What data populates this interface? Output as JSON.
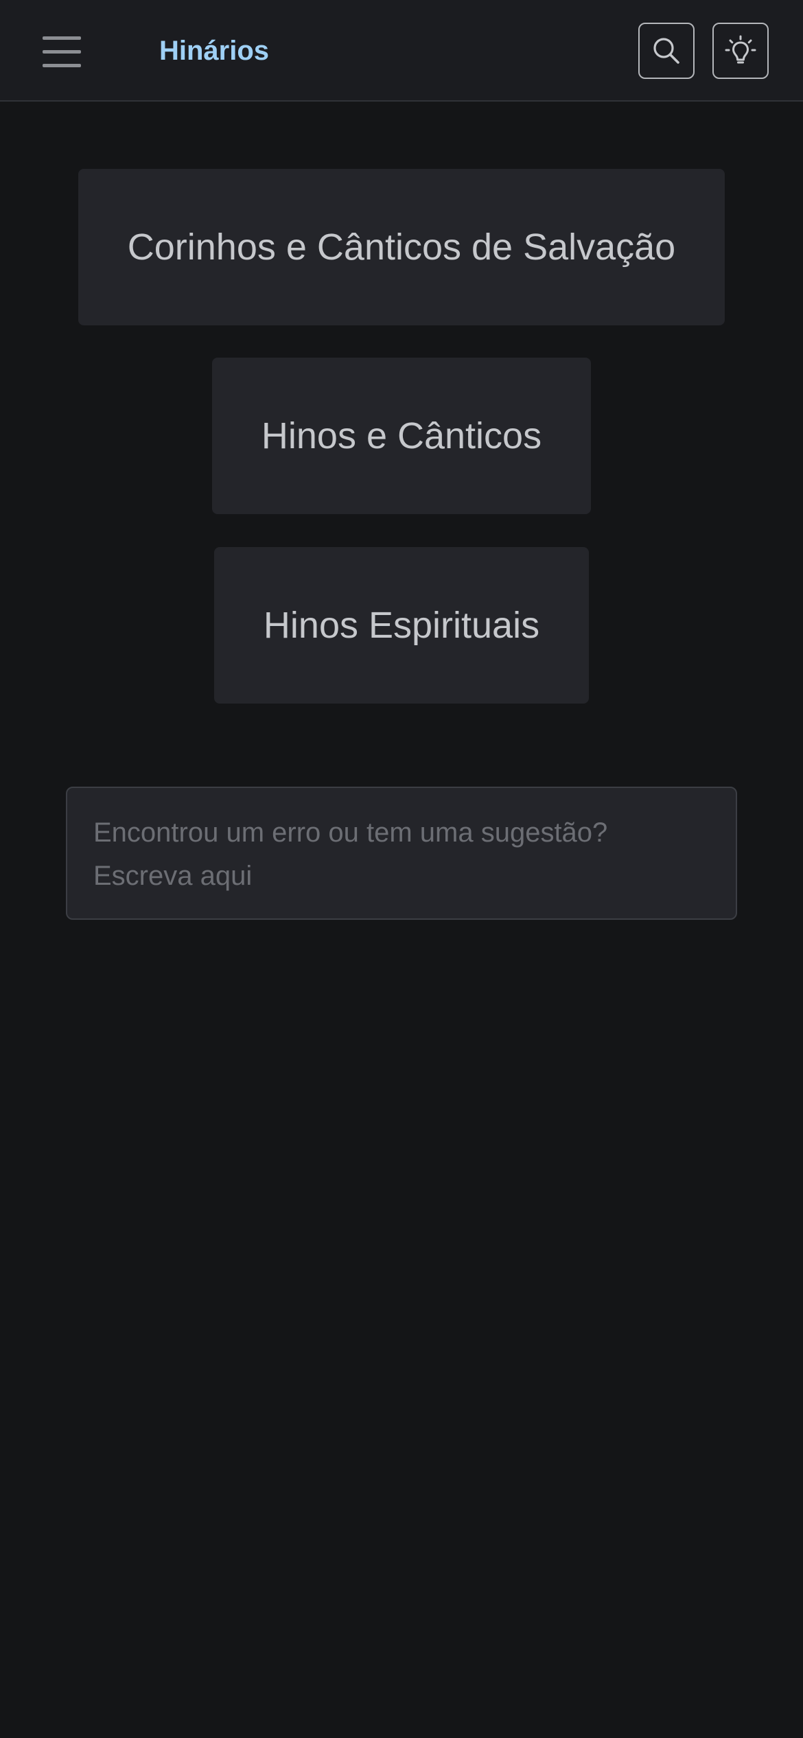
{
  "header": {
    "menu_icon": "hamburger-menu-icon",
    "title": "Hinários",
    "title_color": "#9fd0f5",
    "search_icon": "search-icon",
    "theme_icon": "lightbulb-icon"
  },
  "categories": [
    {
      "label": "Corinhos e Cânticos de Salvação"
    },
    {
      "label": "Hinos e Cânticos"
    },
    {
      "label": "Hinos Espirituais"
    }
  ],
  "feedback": {
    "value": "",
    "placeholder": "Encontrou um erro ou tem uma sugestão? Escreva aqui"
  },
  "colors": {
    "background": "#141517",
    "header_background": "#1b1c20",
    "card_background": "#24252a",
    "text": "#c6c8cc",
    "placeholder": "#6c6e74"
  }
}
